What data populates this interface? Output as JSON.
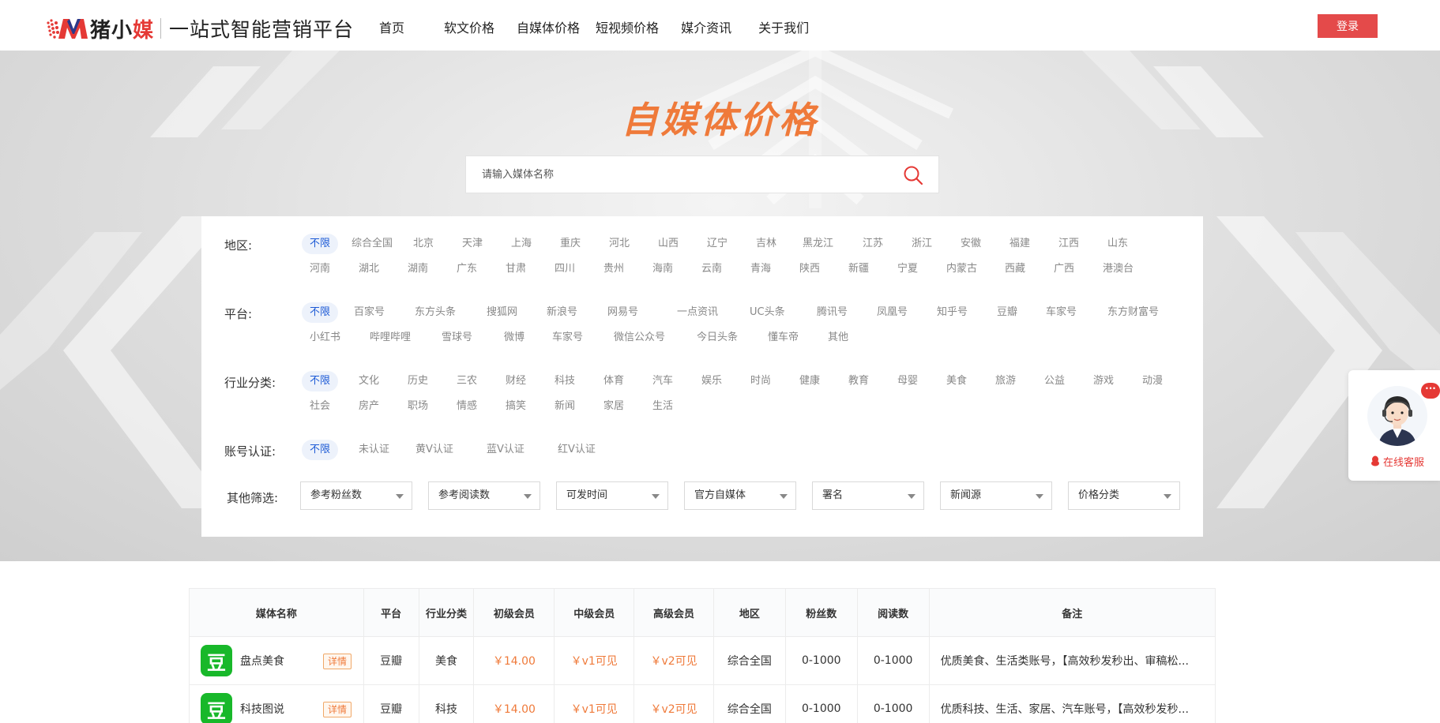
{
  "header": {
    "brand": "猪小",
    "brand_red": "媒",
    "slogan": "一站式智能营销平台",
    "nav": [
      "首页",
      "软文价格",
      "自媒体价格",
      "短视频价格",
      "媒介资讯",
      "关于我们"
    ],
    "login_label": "登录"
  },
  "banner": {
    "title": "自媒体价格",
    "search_placeholder": "请输入媒体名称"
  },
  "filters": {
    "region": {
      "label": "地区:",
      "options": [
        "不限",
        "综合全国",
        "北京",
        "天津",
        "上海",
        "重庆",
        "河北",
        "山西",
        "辽宁",
        "吉林",
        "黑龙江",
        "江苏",
        "浙江",
        "安徽",
        "福建",
        "江西",
        "山东",
        "河南",
        "湖北",
        "湖南",
        "广东",
        "甘肃",
        "四川",
        "贵州",
        "海南",
        "云南",
        "青海",
        "陕西",
        "新疆",
        "宁夏",
        "内蒙古",
        "西藏",
        "广西",
        "港澳台"
      ]
    },
    "platform": {
      "label": "平台:",
      "options": [
        "不限",
        "百家号",
        "东方头条",
        "搜狐网",
        "新浪号",
        "网易号",
        "一点资讯",
        "UC头条",
        "腾讯号",
        "凤凰号",
        "知乎号",
        "豆瓣",
        "车家号",
        "东方财富号",
        "小红书",
        "哔哩哔哩",
        "雪球号",
        "微博",
        "车家号",
        "微信公众号",
        "今日头条",
        "懂车帝",
        "其他"
      ]
    },
    "industry": {
      "label": "行业分类:",
      "options": [
        "不限",
        "文化",
        "历史",
        "三农",
        "财经",
        "科技",
        "体育",
        "汽车",
        "娱乐",
        "时尚",
        "健康",
        "教育",
        "母婴",
        "美食",
        "旅游",
        "公益",
        "游戏",
        "动漫",
        "社会",
        "房产",
        "职场",
        "情感",
        "搞笑",
        "新闻",
        "家居",
        "生活"
      ]
    },
    "verify": {
      "label": "账号认证:",
      "options": [
        "不限",
        "未认证",
        "黄V认证",
        "蓝V认证",
        "红V认证"
      ]
    },
    "other": {
      "label": "其他筛选:",
      "selects": [
        "参考粉丝数",
        "参考阅读数",
        "可发时间",
        "官方自媒体",
        "署名",
        "新闻源",
        "价格分类"
      ]
    }
  },
  "service": {
    "label": "在线客服",
    "bubble": "···"
  },
  "table": {
    "headers": [
      "媒体名称",
      "平台",
      "行业分类",
      "初级会员",
      "中级会员",
      "高级会员",
      "地区",
      "粉丝数",
      "阅读数",
      "备注"
    ],
    "detail_label": "详情",
    "rows": [
      {
        "icon": "豆",
        "name": "盘点美食",
        "platform": "豆瓣",
        "industry": "美食",
        "p1": "￥14.00",
        "p2": "￥v1可见",
        "p3": "￥v2可见",
        "region": "综合全国",
        "fans": "0-1000",
        "reads": "0-1000",
        "remark": "优质美食、生活类账号，【高效秒发秒出、审稿松..."
      },
      {
        "icon": "豆",
        "name": "科技图说",
        "platform": "豆瓣",
        "industry": "科技",
        "p1": "￥14.00",
        "p2": "￥v1可见",
        "p3": "￥v2可见",
        "region": "综合全国",
        "fans": "0-1000",
        "reads": "0-1000",
        "remark": "优质科技、生活、家居、汽车账号，【高效秒发秒..."
      }
    ]
  },
  "colors": {
    "accent_orange": "#ef7a3a",
    "login_red": "#e44a4a",
    "active_blue": "#1e5bd6",
    "douban_green": "#18b82a"
  }
}
